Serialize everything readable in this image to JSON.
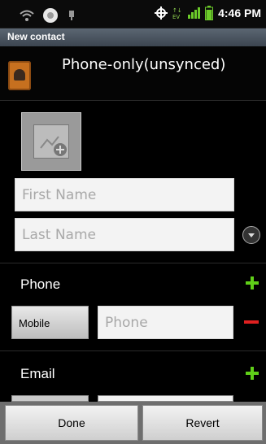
{
  "status_bar": {
    "time": "4:46 PM",
    "icons": [
      "wifi-icon",
      "sync-icon",
      "usb-icon",
      "gps-icon",
      "ev-icon",
      "signal-icon",
      "battery-icon"
    ]
  },
  "title_bar": {
    "title": "New contact"
  },
  "account": {
    "name": "Phone-only(unsynced)",
    "icon": "contacts-book-icon"
  },
  "photo": {
    "icon": "add-photo-icon"
  },
  "name_fields": {
    "first_placeholder": "First Name",
    "last_placeholder": "Last Name"
  },
  "phone_section": {
    "label": "Phone",
    "type": "Mobile",
    "placeholder": "Phone"
  },
  "email_section": {
    "label": "Email"
  },
  "buttons": {
    "done": "Done",
    "revert": "Revert"
  },
  "colors": {
    "add": "#5fcf18",
    "remove": "#e02020",
    "titlebar": "#4b5560"
  }
}
